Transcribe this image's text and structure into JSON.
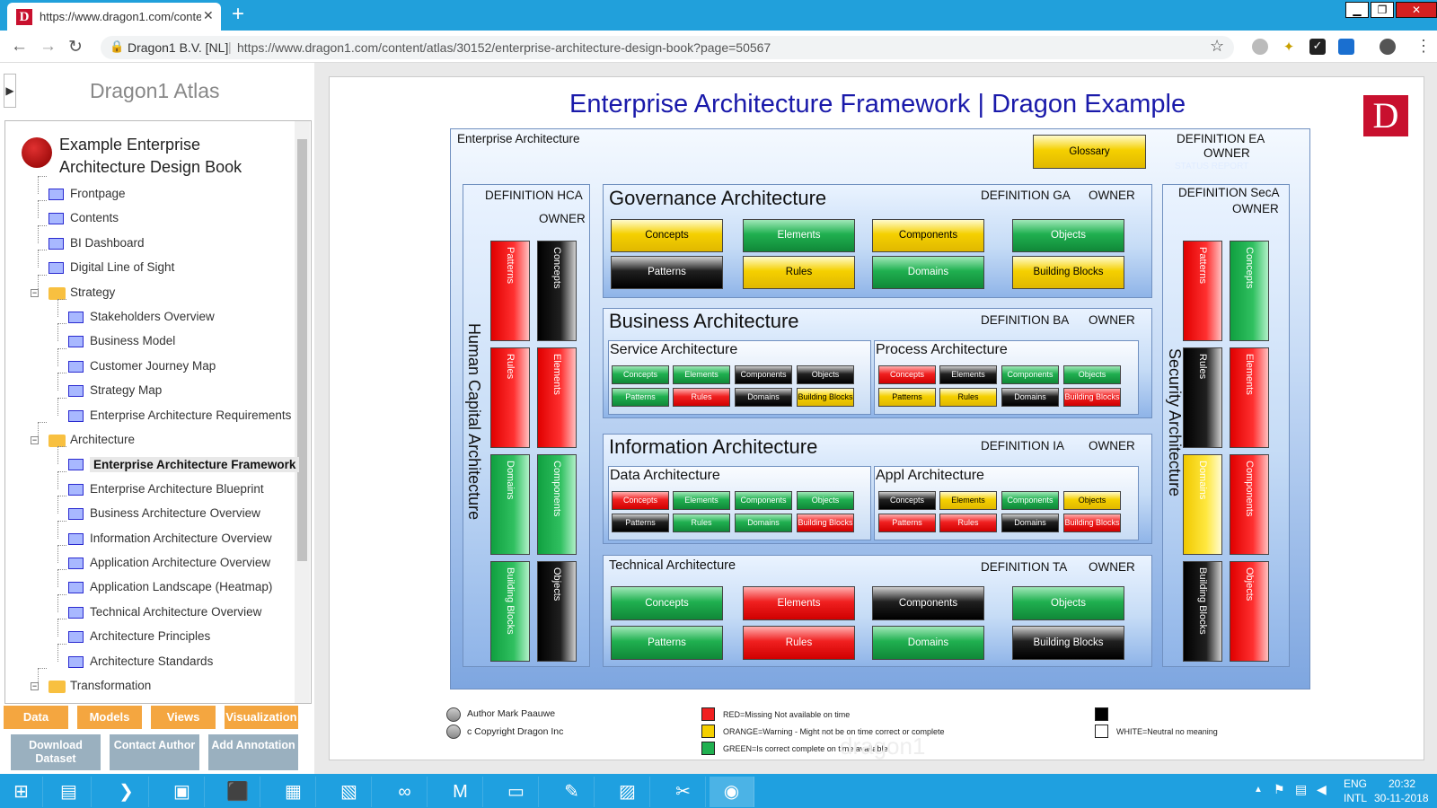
{
  "browser": {
    "tab_title": "https://www.dragon1.com/conte",
    "site_name": "Dragon1 B.V. [NL]",
    "separator": "|",
    "url": "https://www.dragon1.com/content/atlas/30152/enterprise-architecture-design-book?page=50567",
    "favicon": "D"
  },
  "sidebar": {
    "atlas_title": "Dragon1 Atlas",
    "book_title": "Example Enterprise Architecture Design Book",
    "items": [
      "Frontpage",
      "Contents",
      "BI Dashboard",
      "Digital Line of Sight",
      "Strategy",
      "Stakeholders Overview",
      "Business Model",
      "Customer Journey Map",
      "Strategy Map",
      "Enterprise Architecture Requirements",
      "Architecture",
      "Enterprise Architecture Framework",
      "Enterprise Architecture Blueprint",
      "Business Architecture Overview",
      "Information Architecture Overview",
      "Application Architecture Overview",
      "Application Landscape (Heatmap)",
      "Technical Architecture Overview",
      "Architecture Principles",
      "Architecture Standards",
      "Transformation"
    ],
    "tabs": [
      "Data",
      "Models",
      "Views",
      "Visualization"
    ],
    "actions": [
      "Download Dataset",
      "Contact Author",
      "Add Annotation"
    ]
  },
  "diagram": {
    "title": "Enterprise Architecture Framework | Dragon Example",
    "logo": "D",
    "ea_label": "Enterprise Architecture",
    "glossary": "Glossary",
    "def_ea": "DEFINITION EA",
    "owner": "OWNER",
    "status_report": "STATUS REPORT",
    "hca": {
      "def": "DEFINITION HCA",
      "vlabel": "Human Capital Architecture",
      "buttons": [
        "Patterns",
        "Concepts",
        "Rules",
        "Elements",
        "Domains",
        "Components",
        "Building Blocks",
        "Objects"
      ]
    },
    "seca": {
      "def": "DEFINITION SecA",
      "vlabel": "Security Architecture",
      "buttons": [
        "Patterns",
        "Concepts",
        "Rules",
        "Elements",
        "Domains",
        "Components",
        "Building Blocks",
        "Objects"
      ]
    },
    "ga": {
      "title": "Governance Architecture",
      "def": "DEFINITION GA",
      "buttons": [
        "Concepts",
        "Elements",
        "Components",
        "Objects",
        "Patterns",
        "Rules",
        "Domains",
        "Building Blocks"
      ]
    },
    "ba": {
      "title": "Business Architecture",
      "def": "DEFINITION BA",
      "left": "Service Architecture",
      "right": "Process Architecture"
    },
    "ia": {
      "title": "Information Architecture",
      "def": "DEFINITION IA",
      "left": "Data Architecture",
      "right": "Appl Architecture"
    },
    "ta": {
      "title": "Technical Architecture",
      "def": "DEFINITION TA",
      "buttons": [
        "Concepts",
        "Elements",
        "Components",
        "Objects",
        "Patterns",
        "Rules",
        "Domains",
        "Building Blocks"
      ]
    },
    "small_buttons": [
      "Concepts",
      "Elements",
      "Components",
      "Objects",
      "Patterns",
      "Rules",
      "Domains",
      "Building Blocks"
    ],
    "legend": {
      "author": "Author Mark Paauwe",
      "copyright": "c Copyright Dragon Inc",
      "red": "RED=Missing Not available on time",
      "orange": "ORANGE=Warning - Might not be on time correct or complete",
      "green": "GREEN=Is correct complete on time available",
      "white": "WHITE=Neutral no meaning",
      "watermark": "dragon1"
    },
    "colors": {
      "red": "#f02020",
      "yellow": "#f5d000",
      "green": "#20b050",
      "black": "#000000"
    }
  },
  "taskbar": {
    "lang1": "ENG",
    "lang2": "INTL",
    "time": "20:32",
    "date": "30-11-2018"
  }
}
